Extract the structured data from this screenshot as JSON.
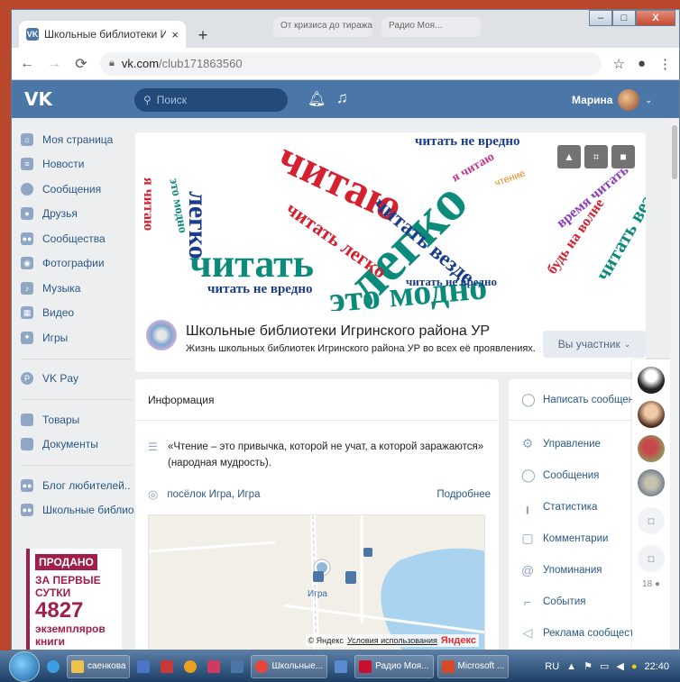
{
  "browser": {
    "tab_title": "Школьные библиотеки Игринск",
    "tab_close": "×",
    "new_tab": "+",
    "bg_tab_1": "От кризиса до тиража",
    "bg_tab_2": "Радио Моя...",
    "url_domain": "vk.com",
    "url_path": "/club171863560"
  },
  "vk_header": {
    "logo": "VK",
    "search_placeholder": "Поиск",
    "user_name": "Марина"
  },
  "left_nav": {
    "items": [
      {
        "label": "Моя страница",
        "icon": "home-icon"
      },
      {
        "label": "Новости",
        "icon": "news-icon"
      },
      {
        "label": "Сообщения",
        "icon": "messages-icon"
      },
      {
        "label": "Друзья",
        "icon": "friends-icon"
      },
      {
        "label": "Сообщества",
        "icon": "groups-icon"
      },
      {
        "label": "Фотографии",
        "icon": "photos-icon"
      },
      {
        "label": "Музыка",
        "icon": "music-icon"
      },
      {
        "label": "Видео",
        "icon": "video-icon"
      },
      {
        "label": "Игры",
        "icon": "games-icon"
      }
    ],
    "vkpay": "VK Pay",
    "goods": "Товары",
    "docs": "Документы",
    "group_1": "Блог любителей..",
    "group_2": "Школьные библио.."
  },
  "ad": {
    "line1": "ПРОДАНО",
    "line2": "ЗА ПЕРВЫЕ СУТКИ",
    "number": "4827",
    "line3": "экземпляров",
    "line4": "книги"
  },
  "group": {
    "name": "Школьные библиотеки Игринского района УР",
    "status": "Жизнь школьных библиотек Игринского района УР во всех её проявлениях.",
    "member_button": "Вы участник"
  },
  "cover_words": {
    "w1": "читать не вредно",
    "w2": "легко",
    "w3": "читаю",
    "w4": "читать",
    "w5": "это модно",
    "w6": "читать везде",
    "w7": "я читаю",
    "w8": "читать не вредно",
    "w9": "время читать",
    "w10": "будь на волне",
    "w11": "читать легко",
    "w12": "читать везде",
    "w13": "легко",
    "w14": "я читаю",
    "w15": "это модно",
    "w16": "читать не вредно"
  },
  "info": {
    "title": "Информация",
    "quote": "«Чтение – это привычка, которой не учат, а которой заражаются» (народная мудрость).",
    "place": "посёлок Игра, Игра",
    "more": "Подробнее",
    "map_city": "Игра",
    "map_copyright": "© Яндекс",
    "map_terms": "Условия использования",
    "map_brand": "Яндекс"
  },
  "right_menu": {
    "items": [
      {
        "label": "Написать сообщение",
        "icon": "chat-bubble-icon"
      },
      {
        "label": "Управление",
        "icon": "gear-icon"
      },
      {
        "label": "Сообщения",
        "icon": "message-icon"
      },
      {
        "label": "Статистика",
        "icon": "stats-icon"
      },
      {
        "label": "Комментарии",
        "icon": "comments-icon"
      },
      {
        "label": "Упоминания",
        "icon": "at-icon"
      },
      {
        "label": "События",
        "icon": "events-icon"
      },
      {
        "label": "Реклама сообщества",
        "icon": "megaphone-icon"
      }
    ]
  },
  "chat": {
    "online_count": "18"
  },
  "taskbar": {
    "item1": "саенкова",
    "item2": "Школьные...",
    "item3": "Радио Моя...",
    "item4": "Microsoft ...",
    "lang": "RU",
    "time": "22:40"
  },
  "colors": {
    "vk_blue": "#4a76a8",
    "link": "#2a5885",
    "ad_accent": "#a01e4a"
  }
}
